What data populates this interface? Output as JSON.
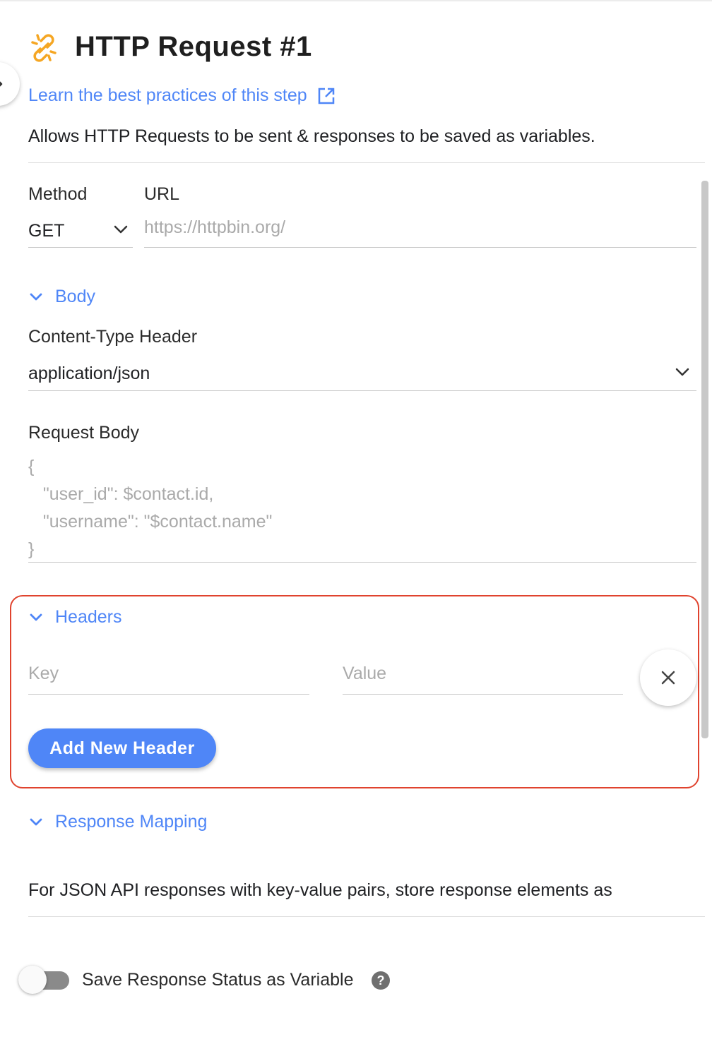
{
  "header": {
    "title": "HTTP Request #1",
    "learn_link": "Learn the best practices of this step",
    "description": "Allows HTTP Requests to be sent & responses to be saved as variables."
  },
  "request": {
    "method_label": "Method",
    "method_value": "GET",
    "url_label": "URL",
    "url_placeholder": "https://httpbin.org/"
  },
  "body_section": {
    "toggle_label": "Body",
    "content_type_label": "Content-Type Header",
    "content_type_value": "application/json",
    "request_body_label": "Request Body",
    "request_body_lines": [
      "{",
      "   \"user_id\": $contact.id,",
      "   \"username\": \"$contact.name\"",
      "}"
    ]
  },
  "headers_section": {
    "toggle_label": "Headers",
    "key_placeholder": "Key",
    "value_placeholder": "Value",
    "add_button": "Add New Header"
  },
  "response_mapping": {
    "toggle_label": "Response Mapping",
    "description": "For JSON API responses with key-value pairs, store response elements as"
  },
  "save_status": {
    "label": "Save Response Status as Variable",
    "enabled": false,
    "help": "?"
  },
  "colors": {
    "accent": "#4f86f7",
    "highlight_border": "#e0432e",
    "icon_orange": "#f5a623"
  },
  "icons": {
    "step": "link-chain-icon",
    "external": "external-link-icon",
    "collapse": "chevron-right-icon",
    "remove": "close-icon"
  }
}
